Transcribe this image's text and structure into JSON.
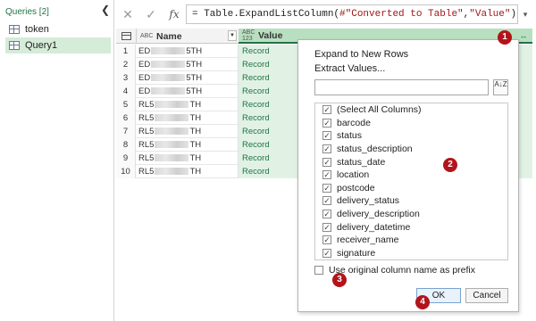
{
  "queries": {
    "header": "Queries [2]",
    "collapse_glyph": "❮",
    "items": [
      {
        "label": "token",
        "selected": false
      },
      {
        "label": "Query1",
        "selected": true
      }
    ]
  },
  "formula_bar": {
    "cancel_glyph": "✕",
    "commit_glyph": "✓",
    "fx_label": "fx",
    "formula_prefix": "= Table.ExpandListColumn(",
    "formula_arg1": "#\"Converted to Table\"",
    "formula_sep": ", ",
    "formula_arg2": "\"Value\"",
    "formula_suffix": ")",
    "expand_glyph": "▾"
  },
  "grid": {
    "columns": [
      {
        "type": "ABC",
        "label": "Name"
      },
      {
        "type": "ABC 123",
        "label": "Value"
      }
    ],
    "name_dropdown_glyph": "▼",
    "expand_glyph": "↔",
    "rows": [
      {
        "n": "1",
        "prefix": "ED",
        "suffix": "5TH",
        "value": "Record"
      },
      {
        "n": "2",
        "prefix": "ED",
        "suffix": "5TH",
        "value": "Record"
      },
      {
        "n": "3",
        "prefix": "ED",
        "suffix": "5TH",
        "value": "Record"
      },
      {
        "n": "4",
        "prefix": "ED",
        "suffix": "5TH",
        "value": "Record"
      },
      {
        "n": "5",
        "prefix": "RL5",
        "suffix": "TH",
        "value": "Record"
      },
      {
        "n": "6",
        "prefix": "RL5",
        "suffix": "TH",
        "value": "Record"
      },
      {
        "n": "7",
        "prefix": "RL5",
        "suffix": "TH",
        "value": "Record"
      },
      {
        "n": "8",
        "prefix": "RL5",
        "suffix": "TH",
        "value": "Record"
      },
      {
        "n": "9",
        "prefix": "RL5",
        "suffix": "TH",
        "value": "Record"
      },
      {
        "n": "10",
        "prefix": "RL5",
        "suffix": "TH",
        "value": "Record"
      }
    ]
  },
  "expand_panel": {
    "expand_rows": "Expand to New Rows",
    "extract_values": "Extract Values...",
    "search_value": "",
    "sort_glyph": "A↓Z",
    "columns": [
      {
        "label": "(Select All Columns)",
        "checked": true
      },
      {
        "label": "barcode",
        "checked": true
      },
      {
        "label": "status",
        "checked": true
      },
      {
        "label": "status_description",
        "checked": true
      },
      {
        "label": "status_date",
        "checked": true
      },
      {
        "label": "location",
        "checked": true
      },
      {
        "label": "postcode",
        "checked": true
      },
      {
        "label": "delivery_status",
        "checked": true
      },
      {
        "label": "delivery_description",
        "checked": true
      },
      {
        "label": "delivery_datetime",
        "checked": true
      },
      {
        "label": "receiver_name",
        "checked": true
      },
      {
        "label": "signature",
        "checked": true
      }
    ],
    "check_glyph": "✓",
    "prefix_label": "Use original column name as prefix",
    "prefix_checked": false,
    "ok_label": "OK",
    "cancel_label": "Cancel"
  },
  "markers": [
    "1",
    "2",
    "3",
    "4"
  ],
  "colors": {
    "accent_green": "#217346",
    "value_column_bg": "#e1f2e4",
    "marker_red": "#b2141a"
  }
}
